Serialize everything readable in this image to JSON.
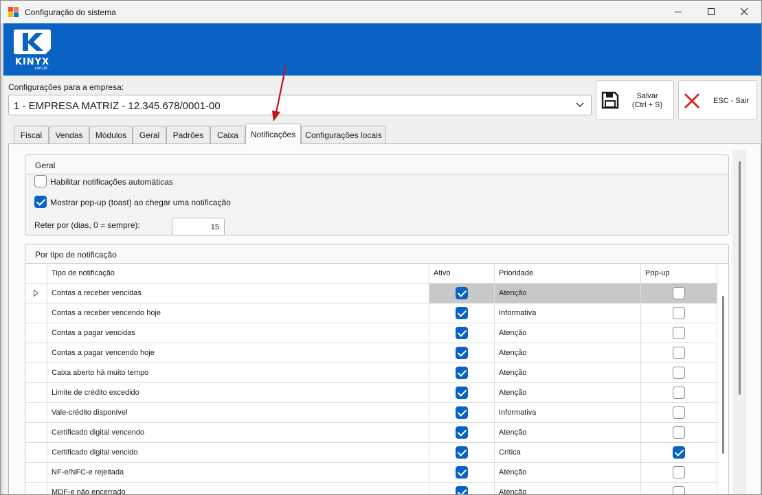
{
  "window": {
    "title": "Configuração do sistema"
  },
  "brand": {
    "logo_text": "KINYX",
    "logo_subtext": ".com.br",
    "banner_color": "#0a63c4"
  },
  "company": {
    "label": "Configurações para a empresa:",
    "selected": "1 - EMPRESA MATRIZ - 12.345.678/0001-00"
  },
  "toolbar": {
    "save_label_line1": "Salvar",
    "save_label_line2": "(Ctrl + S)",
    "exit_label": "ESC - Sair"
  },
  "tabs": [
    {
      "label": "Fiscal"
    },
    {
      "label": "Vendas"
    },
    {
      "label": "Módulos"
    },
    {
      "label": "Geral"
    },
    {
      "label": "Padrões"
    },
    {
      "label": "Caixa"
    },
    {
      "label": "Notificações",
      "active": true
    },
    {
      "label": "Configurações locais"
    }
  ],
  "geral": {
    "title": "Geral",
    "auto_notifications_label": "Habilitar notificações automáticas",
    "auto_notifications_checked": false,
    "toast_label": "Mostrar pop-up (toast) ao chegar uma notificação",
    "toast_checked": true,
    "retain_label": "Reter por (dias, 0 = sempre):",
    "retain_value": "15"
  },
  "types": {
    "title": "Por tipo de notificação",
    "columns": {
      "type": "Tipo de notificação",
      "active": "Ativo",
      "priority": "Prioridade",
      "popup": "Pop-up"
    },
    "rows": [
      {
        "type": "Contas a receber vencidas",
        "active": true,
        "priority": "Atenção",
        "popup": false
      },
      {
        "type": "Contas a receber vencendo hoje",
        "active": true,
        "priority": "Informativa",
        "popup": false
      },
      {
        "type": "Contas a pagar vencidas",
        "active": true,
        "priority": "Atenção",
        "popup": false
      },
      {
        "type": "Contas a pagar vencendo hoje",
        "active": true,
        "priority": "Atenção",
        "popup": false
      },
      {
        "type": "Caixa aberto há muito tempo",
        "active": true,
        "priority": "Atenção",
        "popup": false
      },
      {
        "type": "Limite de crédito excedido",
        "active": true,
        "priority": "Atenção",
        "popup": false
      },
      {
        "type": "Vale-crédito disponível",
        "active": true,
        "priority": "Informativa",
        "popup": false
      },
      {
        "type": "Certificado digital vencendo",
        "active": true,
        "priority": "Atenção",
        "popup": false
      },
      {
        "type": "Certificado digital vencido",
        "active": true,
        "priority": "Crítica",
        "popup": true
      },
      {
        "type": "NF-e/NFC-e rejeitada",
        "active": true,
        "priority": "Atenção",
        "popup": false
      },
      {
        "type": "MDF-e não encerrado",
        "active": true,
        "priority": "Atenção",
        "popup": false
      }
    ]
  },
  "annotation": {
    "arrow_color": "#c0141c"
  }
}
